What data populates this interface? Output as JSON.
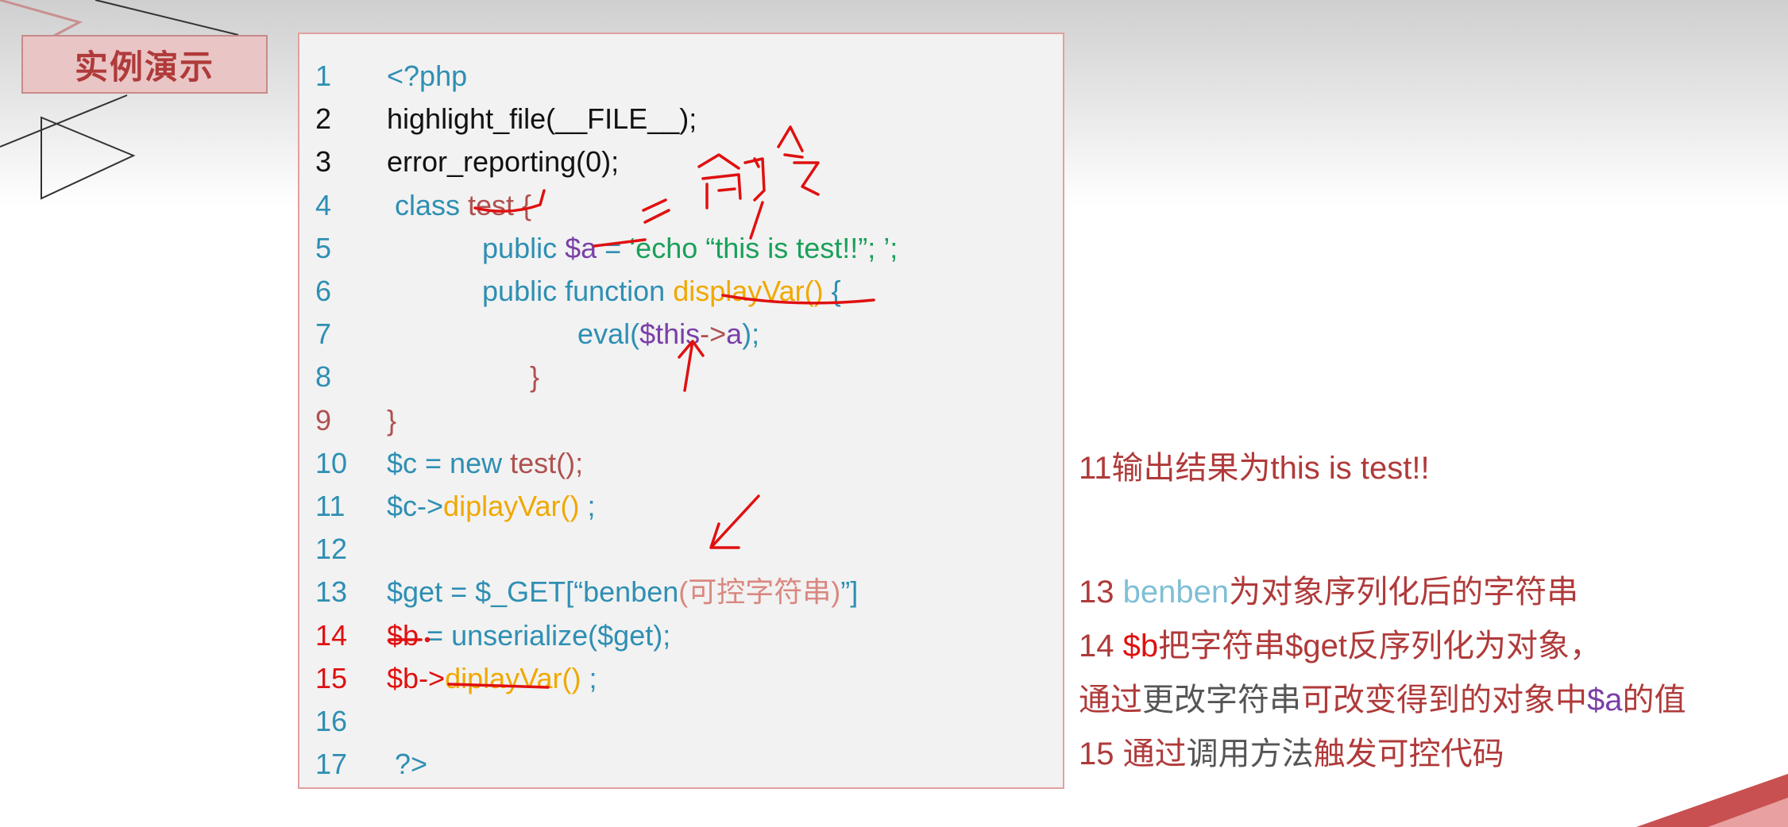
{
  "header": {
    "title": "实例演示"
  },
  "code_lines": [
    {
      "num": "1",
      "num_color": "#2e8fb3",
      "parts": [
        [
          "<?php",
          "#2e8fb3"
        ]
      ]
    },
    {
      "num": "2",
      "num_color": "#111111",
      "parts": [
        [
          "highlight_file(__FILE__);",
          "#111111"
        ]
      ]
    },
    {
      "num": "3",
      "num_color": "#111111",
      "parts": [
        [
          "error_reporting(0);",
          "#111111"
        ]
      ]
    },
    {
      "num": "4",
      "num_color": "#2e8fb3",
      "parts": [
        [
          " class ",
          "#2e8fb3"
        ],
        [
          "test {",
          "#b05050"
        ]
      ]
    },
    {
      "num": "5",
      "num_color": "#2e8fb3",
      "parts": [
        [
          "            public ",
          "#2e8fb3"
        ],
        [
          "$a",
          "#7a3fa8"
        ],
        [
          " = ",
          "#2e8fb3"
        ],
        [
          "‘echo “this is test!!”; ’;",
          "#1aa05a"
        ]
      ]
    },
    {
      "num": "6",
      "num_color": "#2e8fb3",
      "parts": [
        [
          "            public function ",
          "#2e8fb3"
        ],
        [
          "displayVar()",
          "#f0a800"
        ],
        [
          " {",
          "#2e8fb3"
        ]
      ]
    },
    {
      "num": "7",
      "num_color": "#2e8fb3",
      "parts": [
        [
          "                        eval(",
          "#2e8fb3"
        ],
        [
          "$this",
          "#7a3fa8"
        ],
        [
          "->",
          "#b05050"
        ],
        [
          "a",
          "#7a3fa8"
        ],
        [
          ");",
          "#2e8fb3"
        ]
      ]
    },
    {
      "num": "8",
      "num_color": "#2e8fb3",
      "parts": [
        [
          "                  }",
          "#b05050"
        ]
      ]
    },
    {
      "num": "9",
      "num_color": "#b05050",
      "parts": [
        [
          "}",
          "#b05050"
        ]
      ]
    },
    {
      "num": "10",
      "num_color": "#2e8fb3",
      "parts": [
        [
          "$c = new ",
          "#2e8fb3"
        ],
        [
          "test();",
          "#b05050"
        ]
      ]
    },
    {
      "num": "11",
      "num_color": "#2e8fb3",
      "parts": [
        [
          "$c->",
          "#2e8fb3"
        ],
        [
          "diplayVar()",
          "#f0a800"
        ],
        [
          " ;",
          "#2e8fb3"
        ]
      ]
    },
    {
      "num": "12",
      "num_color": "#2e8fb3",
      "parts": []
    },
    {
      "num": "13",
      "num_color": "#2e8fb3",
      "parts": [
        [
          "$get = $_GET[“benben",
          "#2e8fb3"
        ],
        [
          "(可控字符串)",
          "#d98880"
        ],
        [
          "”]",
          "#2e8fb3"
        ]
      ]
    },
    {
      "num": "14",
      "num_color": "#e01010",
      "parts": [
        [
          "$b",
          "#e01010"
        ],
        [
          " = unserialize($get);",
          "#2e8fb3"
        ]
      ]
    },
    {
      "num": "15",
      "num_color": "#e01010",
      "parts": [
        [
          "$b->",
          "#e01010"
        ],
        [
          "diplayVar()",
          "#f0a800"
        ],
        [
          " ;",
          "#2e8fb3"
        ]
      ]
    },
    {
      "num": "16",
      "num_color": "#2e8fb3",
      "parts": []
    },
    {
      "num": "17",
      "num_color": "#2e8fb3",
      "parts": [
        [
          " ?>",
          "#2e8fb3"
        ]
      ]
    }
  ],
  "notes": [
    {
      "parts": [
        [
          "11输出结果为this is test!!",
          "#b03a3a"
        ]
      ]
    },
    {
      "parts": [
        [
          "13 ",
          "#b03a3a"
        ],
        [
          "benben",
          "#7fbfd6"
        ],
        [
          "为对象序列化后的字符串",
          "#b03a3a"
        ]
      ]
    },
    {
      "parts": [
        [
          "14 ",
          "#b03a3a"
        ],
        [
          "$b",
          "#e01010"
        ],
        [
          "把字符串$get反序列化为对象，",
          "#b03a3a"
        ]
      ]
    },
    {
      "parts": [
        [
          "通过",
          "#b03a3a"
        ],
        [
          "更改字符串",
          "#555555"
        ],
        [
          "可改变得到的对象中",
          "#b03a3a"
        ],
        [
          "$a",
          "#7a3fa8"
        ],
        [
          "的值",
          "#b03a3a"
        ]
      ]
    },
    {
      "parts": [
        [
          "15 ",
          "#b03a3a"
        ],
        [
          "通过",
          "#b03a3a"
        ],
        [
          "调用方法",
          "#555555"
        ],
        [
          "触发可控代码",
          "#b03a3a"
        ]
      ]
    }
  ],
  "annotations": {
    "handwriting": "命令"
  }
}
